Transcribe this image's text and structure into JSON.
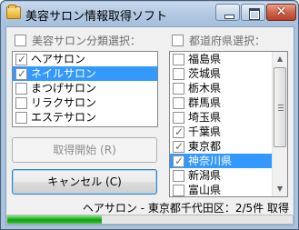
{
  "window": {
    "title": "美容サロン情報取得ソフト",
    "close_glyph": "✕"
  },
  "category": {
    "header_label": "美容サロン分類選択：",
    "header_checked": false,
    "items": [
      {
        "label": "ヘアサロン",
        "checked": true,
        "selected": false
      },
      {
        "label": "ネイルサロン",
        "checked": true,
        "selected": true
      },
      {
        "label": "まつげサロン",
        "checked": false,
        "selected": false
      },
      {
        "label": "リラクサロン",
        "checked": false,
        "selected": false
      },
      {
        "label": "エステサロン",
        "checked": false,
        "selected": false
      }
    ]
  },
  "prefecture": {
    "header_label": "都道府県選択：",
    "header_checked": false,
    "items": [
      {
        "label": "福島県",
        "checked": false,
        "selected": false
      },
      {
        "label": "茨城県",
        "checked": false,
        "selected": false
      },
      {
        "label": "栃木県",
        "checked": false,
        "selected": false
      },
      {
        "label": "群馬県",
        "checked": false,
        "selected": false
      },
      {
        "label": "埼玉県",
        "checked": false,
        "selected": false
      },
      {
        "label": "千葉県",
        "checked": true,
        "selected": false
      },
      {
        "label": "東京都",
        "checked": true,
        "selected": false
      },
      {
        "label": "神奈川県",
        "checked": true,
        "selected": true
      },
      {
        "label": "新潟県",
        "checked": false,
        "selected": false
      },
      {
        "label": "富山県",
        "checked": false,
        "selected": false
      }
    ]
  },
  "buttons": {
    "fetch_label": "取得開始 (R)",
    "cancel_label": "キャンセル (C)"
  },
  "status": {
    "text": "ヘアサロン - 東京都千代田区：2/5件 取得",
    "progress_fraction": 0.33
  },
  "colors": {
    "selection": "#3399ff",
    "progress": "#1fb31f"
  }
}
